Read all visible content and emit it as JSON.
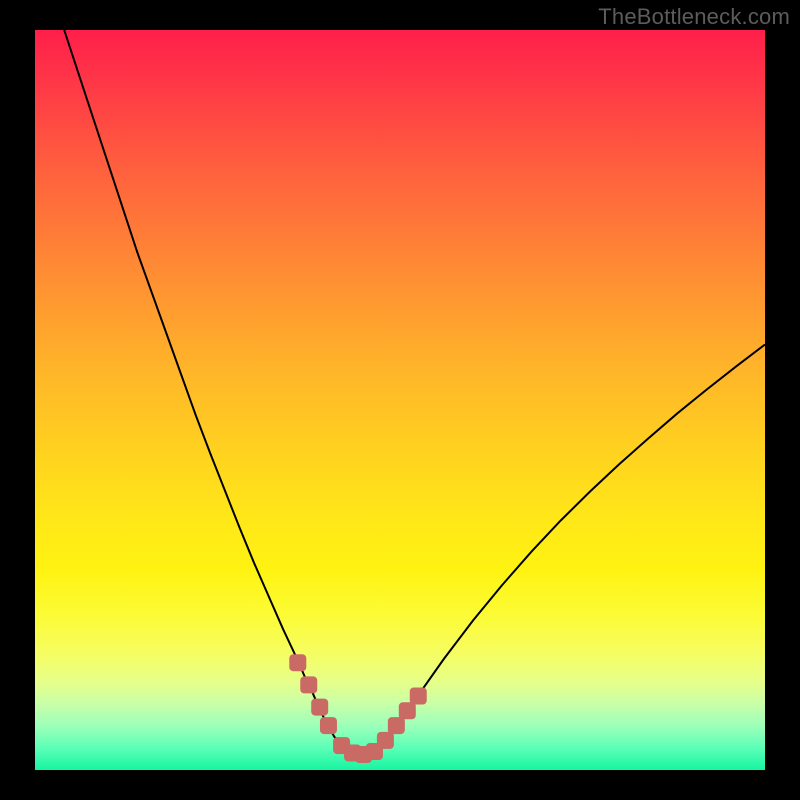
{
  "watermark": "TheBottleneck.com",
  "colors": {
    "page_bg": "#000000",
    "watermark": "#5c5c5c",
    "curve": "#000000",
    "marker": "#c96a64",
    "gradient_top": "#ff1f4a",
    "gradient_bottom": "#17f5a0"
  },
  "chart_data": {
    "type": "line",
    "title": "",
    "xlabel": "",
    "ylabel": "",
    "xlim": [
      0,
      100
    ],
    "ylim": [
      0,
      100
    ],
    "grid": false,
    "legend": false,
    "series": [
      {
        "name": "bottleneck-curve",
        "x": [
          4,
          6,
          8,
          10,
          12,
          14,
          16,
          18,
          20,
          22,
          24,
          26,
          28,
          30,
          32,
          34,
          36,
          37,
          38,
          39,
          40,
          41,
          42,
          43,
          44,
          45,
          46,
          48,
          50,
          52,
          56,
          60,
          64,
          68,
          72,
          76,
          80,
          84,
          88,
          92,
          96,
          100
        ],
        "y": [
          100,
          94,
          88,
          82,
          76,
          70,
          64.5,
          59,
          53.5,
          48,
          42.8,
          37.8,
          32.8,
          28,
          23.5,
          19,
          14.8,
          12.5,
          10.5,
          8.2,
          6.2,
          4.5,
          3.2,
          2.4,
          2.0,
          2.0,
          2.4,
          4.0,
          6.6,
          9.4,
          15,
          20.2,
          25,
          29.5,
          33.7,
          37.6,
          41.3,
          44.8,
          48.2,
          51.4,
          54.5,
          57.5
        ]
      }
    ],
    "annotations": [
      {
        "name": "marker-left-upper",
        "x": 36.0,
        "y": 14.5
      },
      {
        "name": "marker-left-1",
        "x": 37.5,
        "y": 11.5
      },
      {
        "name": "marker-left-2",
        "x": 39.0,
        "y": 8.5
      },
      {
        "name": "marker-left-3",
        "x": 40.2,
        "y": 6.0
      },
      {
        "name": "marker-bottom-1",
        "x": 42.0,
        "y": 3.3
      },
      {
        "name": "marker-bottom-2",
        "x": 43.5,
        "y": 2.3
      },
      {
        "name": "marker-bottom-3",
        "x": 45.0,
        "y": 2.1
      },
      {
        "name": "marker-bottom-4",
        "x": 46.5,
        "y": 2.5
      },
      {
        "name": "marker-right-1",
        "x": 48.0,
        "y": 4.0
      },
      {
        "name": "marker-right-2",
        "x": 49.5,
        "y": 6.0
      },
      {
        "name": "marker-right-3",
        "x": 51.0,
        "y": 8.0
      },
      {
        "name": "marker-right-upper",
        "x": 52.5,
        "y": 10.0
      }
    ]
  }
}
